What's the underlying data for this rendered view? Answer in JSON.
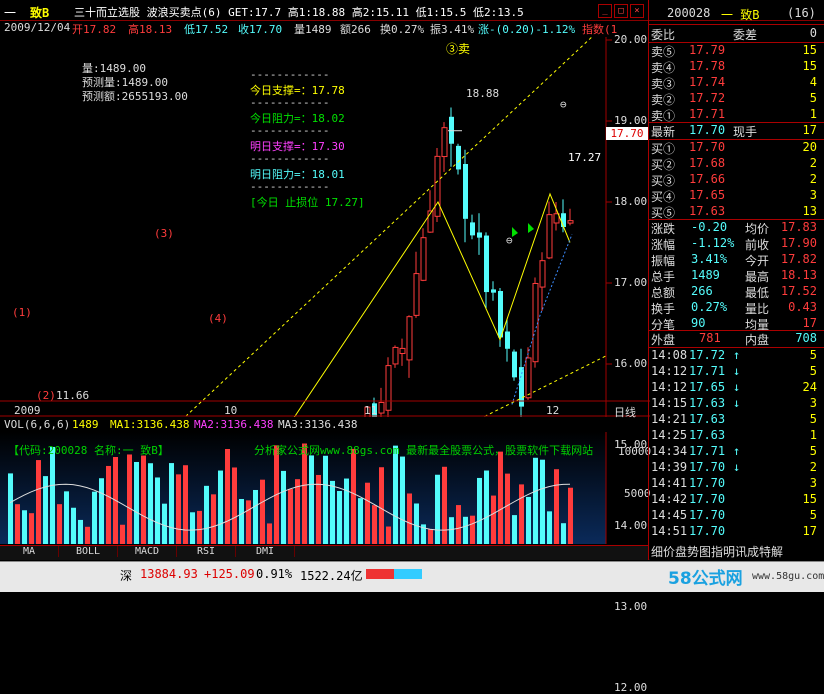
{
  "titlebar": {
    "menu_char": "一",
    "stock_name": "致B",
    "title_text": "三十而立选股 波浪买卖点(6) GET:17.7 高1:18.88 高2:15.11 低1:15.5 低2:13.5"
  },
  "infobar": {
    "date": "2009/12/04",
    "open": "开17.82",
    "high": "高18.13",
    "low": "低17.52",
    "close": "收17.70",
    "volume": "量1489",
    "amount": "额266",
    "turnover": "换0.27%",
    "amplitude": "振3.41%",
    "change": "涨-(0.20)-1.12%",
    "index_btn": "指数(1"
  },
  "chart": {
    "y_ticks": [
      "20.00",
      "19.00",
      "18.00",
      "17.00",
      "16.00",
      "15.00",
      "14.00",
      "13.00",
      "12.00"
    ],
    "x_ticks": [
      "2009",
      "10",
      "11",
      "12"
    ],
    "x_axis_right_label": "日线",
    "current_price_tag": "17.70",
    "label_3sell": "③卖",
    "label_high": "18.88",
    "label_low": "11.66",
    "label_1": "(1)",
    "label_2": "(2)",
    "label_3": "(3)",
    "label_4": "(4)",
    "label_1727": "17.27",
    "label_minus1": "⊖",
    "label_minus2": "⊖",
    "info_volume": "量:1489.00",
    "info_pred_volume": "预测量:1489.00",
    "info_pred_amount": "预测额:2655193.00",
    "dash_line": "------------",
    "support_today": "今日支撑=：17.78",
    "resist_today": "今日阻力=：18.02",
    "support_tomorrow": "明日支撑=：17.30",
    "resist_tomorrow": "明日阻力=：18.01",
    "stoploss": "[今日 止损位 17.27]"
  },
  "volume_panel": {
    "header_prefix": "VOL(6,6,6)",
    "vol_value": "1489",
    "ma1": "MA1:3136.438",
    "ma2": "MA2:3136.438",
    "ma3": "MA3:3136.438",
    "code_label": "【代码:200028 名称:一  致B】",
    "ad_text": "分析家公式网www.88gs.com 最新最全股票公式，股票软件下载网站",
    "y_ticks": [
      "10000",
      "5000"
    ]
  },
  "tabs": [
    "MA",
    "BOLL",
    "MACD",
    "RSI",
    "DMI"
  ],
  "right_panel": {
    "code": "200028",
    "name": "一  致B",
    "level": "(16)",
    "wei_bi": "委比",
    "wei_cha": "委差",
    "wei_cha_val": "0",
    "asks": [
      {
        "label": "卖⑤",
        "price": "17.79",
        "vol": "15"
      },
      {
        "label": "卖④",
        "price": "17.78",
        "vol": "15"
      },
      {
        "label": "卖③",
        "price": "17.74",
        "vol": "4"
      },
      {
        "label": "卖②",
        "price": "17.72",
        "vol": "5"
      },
      {
        "label": "卖①",
        "price": "17.71",
        "vol": "1"
      }
    ],
    "latest": {
      "label": "最新",
      "price": "17.70",
      "label2": "现手",
      "val": "17"
    },
    "bids": [
      {
        "label": "买①",
        "price": "17.70",
        "vol": "20"
      },
      {
        "label": "买②",
        "price": "17.68",
        "vol": "2"
      },
      {
        "label": "买③",
        "price": "17.66",
        "vol": "2"
      },
      {
        "label": "买④",
        "price": "17.65",
        "vol": "3"
      },
      {
        "label": "买⑤",
        "price": "17.63",
        "vol": "13"
      }
    ],
    "stats": [
      {
        "l1": "涨跌",
        "v1": "-0.20",
        "l2": "均价",
        "v2": "17.83"
      },
      {
        "l1": "涨幅",
        "v1": "-1.12%",
        "l2": "前收",
        "v2": "17.90"
      },
      {
        "l1": "振幅",
        "v1": "3.41%",
        "l2": "今开",
        "v2": "17.82"
      },
      {
        "l1": "总手",
        "v1": "1489",
        "l2": "最高",
        "v2": "18.13"
      },
      {
        "l1": "总额",
        "v1": "266",
        "l2": "最低",
        "v2": "17.52"
      },
      {
        "l1": "换手",
        "v1": "0.27%",
        "l2": "量比",
        "v2": "0.43"
      },
      {
        "l1": "分笔",
        "v1": "90",
        "l2": "均量",
        "v2": "17"
      }
    ],
    "outer_label": "外盘",
    "outer_val": "781",
    "inner_label": "内盘",
    "inner_val": "708",
    "ticks": [
      {
        "time": "14:08",
        "price": "17.72",
        "arrow": "↑",
        "vol": "5"
      },
      {
        "time": "14:12",
        "price": "17.71",
        "arrow": "↓",
        "vol": "5"
      },
      {
        "time": "14:12",
        "price": "17.65",
        "arrow": "↓",
        "vol": "24"
      },
      {
        "time": "14:15",
        "price": "17.63",
        "arrow": "↓",
        "vol": "3"
      },
      {
        "time": "14:21",
        "price": "17.63",
        "arrow": "",
        "vol": "5"
      },
      {
        "time": "14:25",
        "price": "17.63",
        "arrow": "",
        "vol": "1"
      },
      {
        "time": "14:34",
        "price": "17.71",
        "arrow": "↑",
        "vol": "5"
      },
      {
        "time": "14:39",
        "price": "17.70",
        "arrow": "↓",
        "vol": "2"
      },
      {
        "time": "14:41",
        "price": "17.70",
        "arrow": "",
        "vol": "3"
      },
      {
        "time": "14:42",
        "price": "17.70",
        "arrow": "",
        "vol": "15"
      },
      {
        "time": "14:45",
        "price": "17.70",
        "arrow": "",
        "vol": "5"
      },
      {
        "time": "14:51",
        "price": "17.70",
        "arrow": "",
        "vol": "17"
      }
    ],
    "bottom_text": "细价盘势图指明讯成特解"
  },
  "statusbar": {
    "market": "深",
    "index": "13884.93",
    "change": "+125.09",
    "pct": "0.91%",
    "amount": "1522.24亿",
    "logo_text": "58公式网",
    "site": "www.58gu.com"
  },
  "colors": {
    "up": "#ff3c3c",
    "down": "#54fcfc",
    "axis": "#a00000",
    "yellow": "#ffff00",
    "green": "#00e000",
    "magenta": "#ff40ff",
    "bg": "#000000"
  }
}
